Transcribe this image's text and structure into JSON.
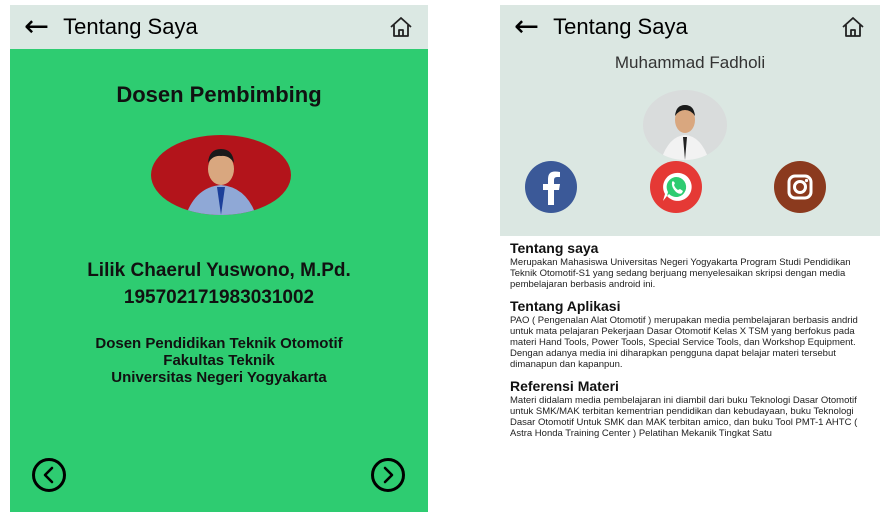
{
  "left": {
    "appbar": {
      "back_icon": "arrow-left-icon",
      "title": "Tentang Saya",
      "home_icon": "home-icon"
    },
    "heading": "Dosen Pembimbing",
    "name": "Lilik Chaerul Yuswono, M.Pd.",
    "nip": "195702171983031002",
    "affiliation": [
      "Dosen Pendidikan Teknik Otomotif",
      "Fakultas Teknik",
      "Universitas Negeri Yogyakarta"
    ],
    "prev_icon": "chevron-left-circle-icon",
    "next_icon": "chevron-right-circle-icon",
    "colors": {
      "background": "#2ecc71",
      "appbar": "#dbe8e3",
      "photo_background": "#b3141b"
    }
  },
  "right": {
    "appbar": {
      "back_icon": "arrow-left-icon",
      "title": "Tentang Saya",
      "home_icon": "home-icon"
    },
    "owner_name": "Muhammad Fadholi",
    "social": [
      {
        "icon": "facebook-icon",
        "color": "#3b5998"
      },
      {
        "icon": "whatsapp-icon",
        "color": "#e53935"
      },
      {
        "icon": "instagram-icon",
        "color": "#8b3a1e"
      }
    ],
    "sections": [
      {
        "title": "Tentang saya",
        "body": "Merupakan Mahasiswa Universitas Negeri Yogyakarta Program Studi Pendidikan Teknik Otomotif-S1 yang sedang berjuang menyelesaikan skripsi dengan media pembelajaran berbasis android ini."
      },
      {
        "title": "Tentang Aplikasi",
        "body": "PAO ( Pengenalan Alat Otomotif ) merupakan media pembelajaran berbasis andrid untuk mata pelajaran Pekerjaan Dasar Otomotif Kelas X TSM yang berfokus pada materi Hand Tools, Power Tools, Special Service Tools, dan Workshop Equipment. Dengan adanya media ini diharapkan pengguna dapat belajar materi tersebut dimanapun dan kapanpun."
      },
      {
        "title": "Referensi Materi",
        "body": "Materi didalam media pembelajaran ini diambil dari buku Teknologi Dasar Otomotif untuk SMK/MAK terbitan kementrian pendidikan dan kebudayaan, buku Teknologi Dasar Otomotif Untuk SMK dan MAK terbitan amico, dan buku Tool PMT-1 AHTC ( Astra Honda Training Center ) Pelatihan Mekanik Tingkat Satu"
      }
    ],
    "colors": {
      "header_background": "#dbe7e2"
    }
  }
}
